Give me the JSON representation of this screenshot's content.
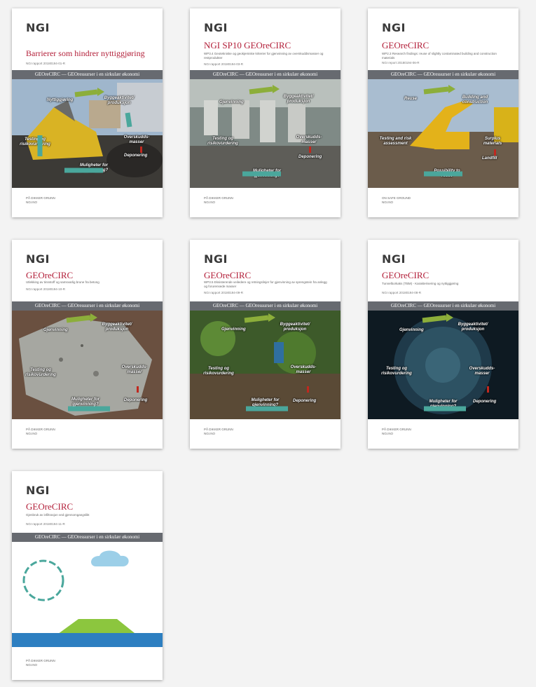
{
  "logo_text": "NGI",
  "band_text": "GEOreCIRC — GEOressurser i en sirkulær økonomi",
  "footer_line1": "PÅ DIKKER GRUNN",
  "footer_line2": "NGI.NO",
  "footer_en_line1": "ON SAFE GROUND",
  "footer_en_line2": "NGI.NO",
  "colors": {
    "title_red": "#b3203a",
    "band_grey": "#676a70",
    "cycle_green": "#8cae3a",
    "cycle_teal": "#4aa79c",
    "deposit_red": "#c0281f"
  },
  "cards": [
    {
      "title": "Barrierer som hindrer nyttiggjøring",
      "subtitle": "",
      "ref": "NGI rapport 20180194-01-R",
      "labels": {
        "a": "Nyttiggjøring",
        "b": "Byggeaktivitet/ produksjon",
        "c": "Testing og risikovurdering",
        "d": "Overskudds- masser",
        "e": "Deponering",
        "f": "Muligheter for nyttiggjøring?"
      }
    },
    {
      "title": "NGI SP10 GEOreCIRC",
      "subtitle": "WP3.4 Geotekniske og geokjemiske kriterier for gjenvinning av overskuddsmasser og restprodukter",
      "ref": "NGI rapport 20180194-03-R",
      "labels": {
        "a": "Gjenvinning",
        "b": "Byggeaktivitet/ produksjon",
        "c": "Testing og risikovurdering",
        "d": "Overskudds- masser",
        "e": "Deponering",
        "f": "Muligheter for gjenvinning?"
      }
    },
    {
      "title": "GEOreCIRC",
      "subtitle": "WP2.3 Research findings: reuse of slightly contaminated building and construction materials",
      "ref": "NGI report 20180194-06-R",
      "labels": {
        "a": "Reuse",
        "b": "Building and construction",
        "c": "Testing and risk assessment",
        "d": "Surplus materials",
        "e": "Landfill",
        "f": "Possibility to reuse"
      }
    },
    {
      "title": "GEOreCIRC",
      "subtitle": "Utlekking av tinnstoff og samsvarlig brune fra betong",
      "ref": "NGI rapport 20180194-10-R",
      "labels": {
        "a": "Gjenvinning",
        "b": "Byggeaktivitet/ produksjon",
        "c": "Testing og risikovurdering",
        "d": "Overskudds- masser",
        "e": "Deponering",
        "f": "Muligheter for gjenvinning?"
      }
    },
    {
      "title": "GEOreCIRC",
      "subtitle": "WP3.5 Eksisterende veiledere og retningslinjer for gjenvinning av sprengstein fra anlegg og forurensede masser",
      "ref": "NGI rapport 20180194-09-R",
      "labels": {
        "a": "Gjenvinning",
        "b": "Byggeaktivitet/ produksjon",
        "c": "Testing og risikovurdering",
        "d": "Overskudds- masser",
        "e": "Deponering",
        "f": "Muligheter for gjenvinning?"
      }
    },
    {
      "title": "GEOreCIRC",
      "subtitle": "Tunnelborkaks (TBM) - Karakterisering og nyttiggjøring",
      "ref": "NGI rapport 20180194-08-R",
      "labels": {
        "a": "Gjenvinning",
        "b": "Byggeaktivitet/ produksjon",
        "c": "Testing og risikovurdering",
        "d": "Overskudds- masser",
        "e": "Deponering",
        "f": "Muligheter for gjenvinning?"
      }
    },
    {
      "title": "GEOreCIRC",
      "subtitle": "Gjenbruk av infiltrasjon ved gjennomgangslikt",
      "ref": "NGI rapport 20180194-11-R",
      "labels": {}
    }
  ]
}
